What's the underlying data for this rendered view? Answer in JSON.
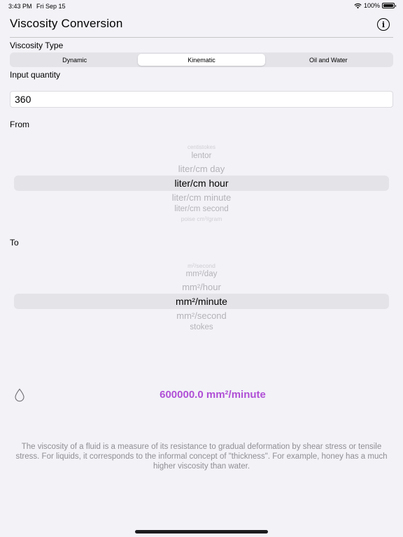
{
  "status": {
    "time": "3:43 PM",
    "date": "Fri Sep 15",
    "battery": "100%",
    "battery_level": 100
  },
  "header": {
    "title": "Viscosity Conversion",
    "info_icon": "info-circle-icon"
  },
  "viscosity_type": {
    "label": "Viscosity Type",
    "options": [
      "Dynamic",
      "Kinematic",
      "Oil and Water"
    ],
    "selected": "Kinematic"
  },
  "input": {
    "label": "Input quantity",
    "value": "360"
  },
  "from": {
    "label": "From",
    "items": [
      "centistokes",
      "lentor",
      "liter/cm day",
      "liter/cm hour",
      "liter/cm minute",
      "liter/cm second",
      "poise cm³/gram"
    ],
    "selected": "liter/cm hour"
  },
  "to": {
    "label": "To",
    "items": [
      "m²/second",
      "mm²/day",
      "mm²/hour",
      "mm²/minute",
      "mm²/second",
      "stokes"
    ],
    "selected": "mm²/minute"
  },
  "result": {
    "icon": "water-drop-icon",
    "text": "600000.0 mm²/minute",
    "color": "#b04fd6"
  },
  "description": "The viscosity of a fluid is a measure of its resistance to gradual deformation by shear stress or tensile stress. For liquids, it corresponds to the informal concept of \"thickness\". For example, honey has a much higher viscosity than water."
}
